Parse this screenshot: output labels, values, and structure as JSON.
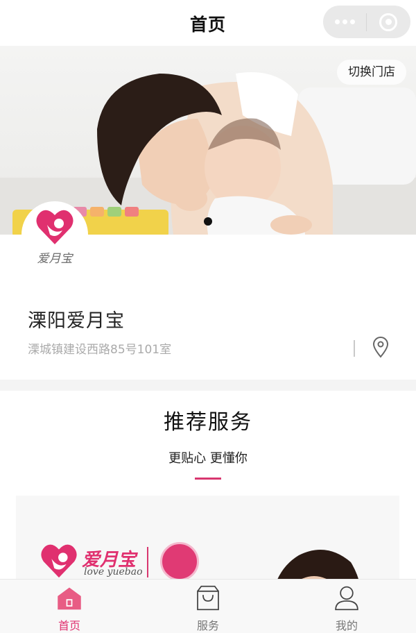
{
  "navbar": {
    "title": "首页",
    "more_icon": "more-dots-icon",
    "close_icon": "mini-program-close-icon"
  },
  "banner": {
    "switch_store_label": "切换门店",
    "slide_count": 1,
    "active_slide": 1
  },
  "store": {
    "logo_text": "爱月宝",
    "name": "溧阳爱月宝",
    "address": "溧城镇建设西路85号101室",
    "location_icon": "map-pin-icon"
  },
  "recommend": {
    "title": "推荐服务",
    "subtitle": "更贴心 更懂你",
    "promo": {
      "brand_cn": "爱月宝",
      "brand_en": "love yuebao"
    }
  },
  "tabbar": {
    "items": [
      {
        "label": "首页",
        "icon": "home-icon",
        "active": true
      },
      {
        "label": "服务",
        "icon": "shopping-bag-icon",
        "active": false
      },
      {
        "label": "我的",
        "icon": "user-icon",
        "active": false
      }
    ]
  },
  "colors": {
    "accent": "#e0306f",
    "tab_inactive": "#777777",
    "address_text": "#aaaaaa"
  }
}
